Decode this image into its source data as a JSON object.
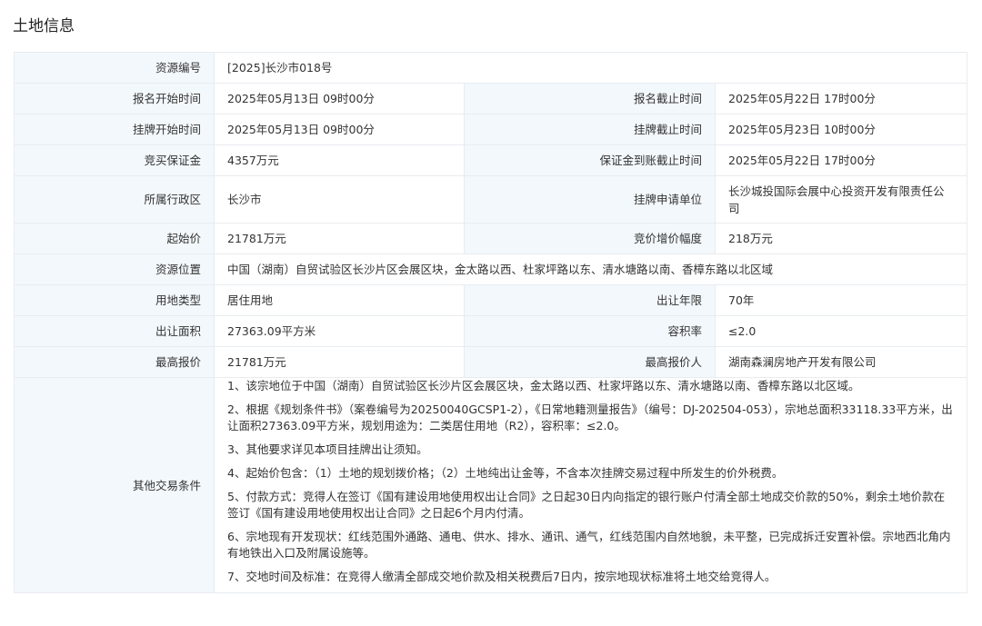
{
  "title": "土地信息",
  "rows": [
    {
      "label": "资源编号",
      "value": "[2025]长沙市018号"
    },
    {
      "label": "报名开始时间",
      "value": "2025年05月13日 09时00分",
      "label2": "报名截止时间",
      "value2": "2025年05月22日 17时00分"
    },
    {
      "label": "挂牌开始时间",
      "value": "2025年05月13日 09时00分",
      "label2": "挂牌截止时间",
      "value2": "2025年05月23日 10时00分"
    },
    {
      "label": "竞买保证金",
      "value": "4357万元",
      "label2": "保证金到账截止时间",
      "value2": "2025年05月22日 17时00分"
    },
    {
      "label": "所属行政区",
      "value": "长沙市",
      "label2": "挂牌申请单位",
      "value2": "长沙城投国际会展中心投资开发有限责任公司"
    },
    {
      "label": "起始价",
      "value": "21781万元",
      "label2": "竞价增价幅度",
      "value2": "218万元"
    },
    {
      "label": "资源位置",
      "value": "中国（湖南）自贸试验区长沙片区会展区块，金太路以西、杜家坪路以东、清水塘路以南、香樟东路以北区域"
    },
    {
      "label": "用地类型",
      "value": "居住用地",
      "label2": "出让年限",
      "value2": "70年"
    },
    {
      "label": "出让面积",
      "value": "27363.09平方米",
      "label2": "容积率",
      "value2": "≤2.0"
    },
    {
      "label": "最高报价",
      "value": "21781万元",
      "label2": "最高报价人",
      "value2": "湖南森澜房地产开发有限公司"
    }
  ],
  "conditions": {
    "label": "其他交易条件",
    "items": [
      "1、该宗地位于中国（湖南）自贸试验区长沙片区会展区块，金太路以西、杜家坪路以东、清水塘路以南、香樟东路以北区域。",
      "2、根据《规划条件书》（案卷编号为20250040GCSP1-2），《日常地籍测量报告》（编号：DJ-202504-053），宗地总面积33118.33平方米，出让面积27363.09平方米，规划用途为：二类居住用地（R2），容积率：≤2.0。",
      "3、其他要求详见本项目挂牌出让须知。",
      "4、起始价包含：（1）土地的规划拨价格；（2）土地纯出让金等，不含本次挂牌交易过程中所发生的价外税费。",
      "5、付款方式：竞得人在签订《国有建设用地使用权出让合同》之日起30日内向指定的银行账户付清全部土地成交价款的50%，剩余土地价款在签订《国有建设用地使用权出让合同》之日起6个月内付清。",
      "6、宗地现有开发现状：红线范围外通路、通电、供水、排水、通讯、通气，红线范围内自然地貌，未平整，已完成拆迁安置补偿。宗地西北角内有地铁出入口及附属设施等。",
      "7、交地时间及标准：在竞得人缴清全部成交地价款及相关税费后7日内，按宗地现状标准将土地交给竞得人。"
    ]
  }
}
